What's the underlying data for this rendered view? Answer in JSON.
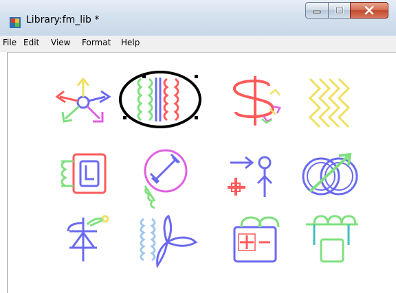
{
  "window": {
    "title": "Library:fm_lib *"
  },
  "title_buttons": {
    "minimize": "minimize-icon",
    "maximize": "maximize-icon",
    "close": "close-icon"
  },
  "menubar": {
    "items": [
      {
        "label": "File"
      },
      {
        "label": "Edit"
      },
      {
        "label": "View"
      },
      {
        "label": "Format"
      },
      {
        "label": "Help"
      }
    ]
  },
  "library": {
    "icons": [
      {
        "name": "arrows-circle-icon",
        "selected": false
      },
      {
        "name": "coil-transformer-icon",
        "selected": true
      },
      {
        "name": "s-coil-icon",
        "selected": false
      },
      {
        "name": "zigzag-waves-icon",
        "selected": false
      },
      {
        "name": "square-l-coil-icon",
        "selected": false
      },
      {
        "name": "circle-dumbbell-icon",
        "selected": false
      },
      {
        "name": "person-arrows-icon",
        "selected": false
      },
      {
        "name": "rings-arrow-icon",
        "selected": false
      },
      {
        "name": "diode-symbol-icon",
        "selected": false
      },
      {
        "name": "coil-propeller-icon",
        "selected": false
      },
      {
        "name": "battery-icon",
        "selected": false
      },
      {
        "name": "coil-box-icon",
        "selected": false
      }
    ]
  },
  "colors": {
    "red": "#ff5a5a",
    "green": "#7fe07f",
    "blue": "#6a6af0",
    "magenta": "#e060e0",
    "yellow": "#f0e060",
    "selection": "#000000"
  }
}
